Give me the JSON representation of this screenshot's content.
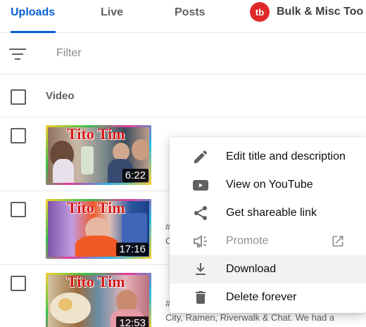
{
  "tabs": {
    "uploads": "Uploads",
    "live": "Live",
    "posts": "Posts",
    "bulk": "Bulk & Misc Too",
    "bulk_logo": "tb"
  },
  "filter": {
    "placeholder": "Filter"
  },
  "table": {
    "header_video": "Video"
  },
  "videos": [
    {
      "thumb_title": "Tito Tim",
      "duration": "6:22",
      "text1": "",
      "text2": ""
    },
    {
      "thumb_title": "Tito Tim",
      "duration": "17:16",
      "text1": "#",
      "text2": "C"
    },
    {
      "thumb_title": "Tito Tim",
      "duration": "12:53",
      "text1": "#",
      "text2": "City, Ramen, Riverwalk & Chat. We had a"
    }
  ],
  "menu": {
    "items": [
      {
        "label": "Edit title and description",
        "icon": "pencil-icon"
      },
      {
        "label": "View on YouTube",
        "icon": "youtube-icon"
      },
      {
        "label": "Get shareable link",
        "icon": "share-icon"
      },
      {
        "label": "Promote",
        "icon": "megaphone-icon",
        "disabled": true
      },
      {
        "label": "Download",
        "icon": "download-icon",
        "hovered": true
      },
      {
        "label": "Delete forever",
        "icon": "trash-icon"
      }
    ]
  },
  "colors": {
    "accent": "#065fd4",
    "tubebuddy": "#e0282b",
    "thumb_title": "#d61515"
  }
}
